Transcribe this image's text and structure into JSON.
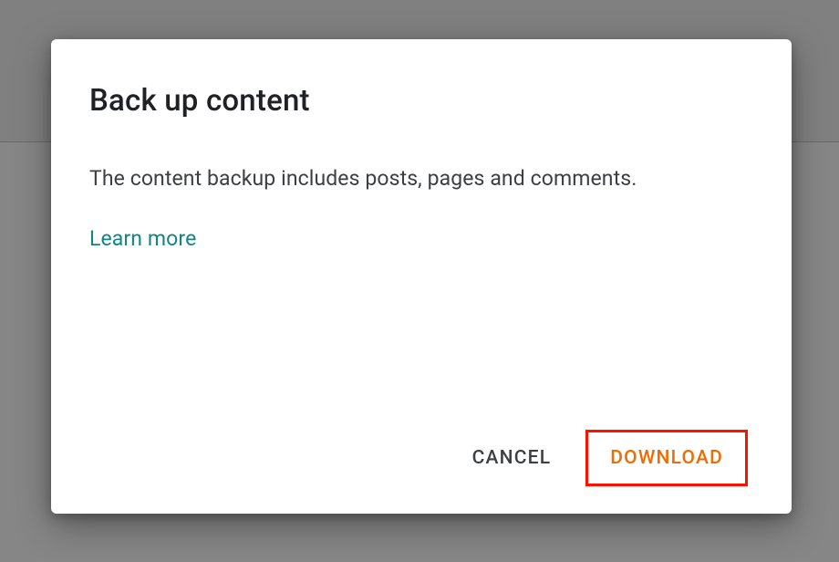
{
  "dialog": {
    "title": "Back up content",
    "body": "The content backup includes posts, pages and comments.",
    "learn_more": "Learn more",
    "actions": {
      "cancel": "CANCEL",
      "download": "DOWNLOAD"
    }
  }
}
